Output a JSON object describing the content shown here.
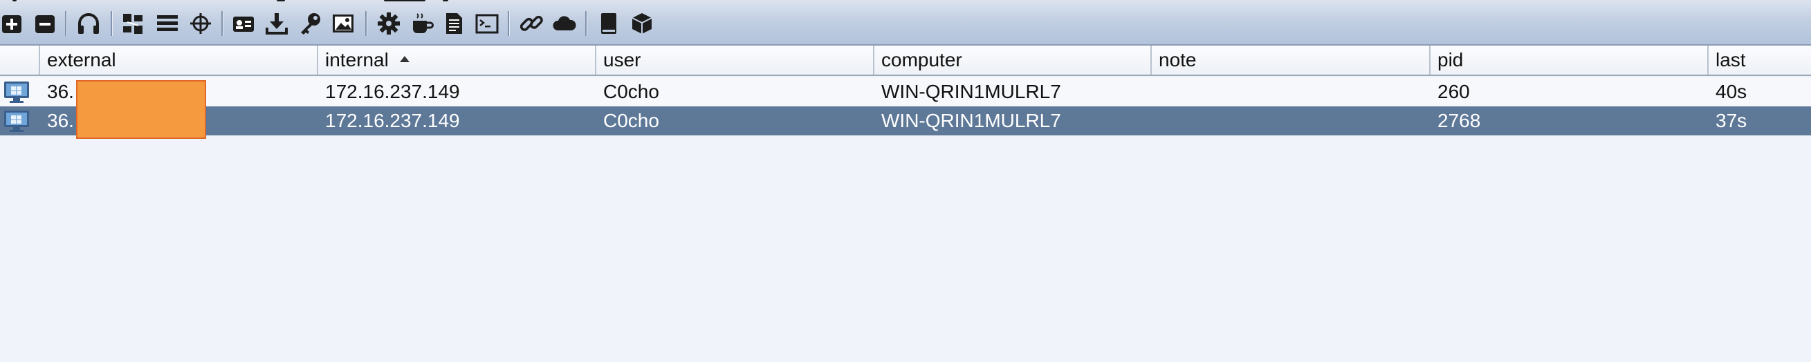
{
  "toolbar": {
    "buttons": [
      {
        "icon": "connect-plus-icon"
      },
      {
        "icon": "disconnect-minus-icon"
      },
      {
        "icon": "headphones-listeners-icon"
      },
      {
        "icon": "pivot-graph-icon"
      },
      {
        "icon": "session-table-icon"
      },
      {
        "icon": "targets-crosshair-icon"
      },
      {
        "icon": "credentials-card-icon"
      },
      {
        "icon": "downloads-icon"
      },
      {
        "icon": "keystrokes-key-icon"
      },
      {
        "icon": "screenshots-image-icon"
      },
      {
        "icon": "payload-gear-icon"
      },
      {
        "icon": "java-cup-icon"
      },
      {
        "icon": "script-document-icon"
      },
      {
        "icon": "console-terminal-icon"
      },
      {
        "icon": "link-chain-icon"
      },
      {
        "icon": "cloud-icon"
      },
      {
        "icon": "manual-book-icon"
      },
      {
        "icon": "package-cube-icon"
      }
    ]
  },
  "table": {
    "columns": [
      {
        "label": ""
      },
      {
        "label": "external"
      },
      {
        "label": "internal"
      },
      {
        "label": "user"
      },
      {
        "label": "computer"
      },
      {
        "label": "note"
      },
      {
        "label": "pid"
      },
      {
        "label": "last"
      }
    ],
    "sorted_column": "internal",
    "sort_direction": "ascending",
    "rows": [
      {
        "external": "36.",
        "internal": "172.16.237.149",
        "user": "C0cho",
        "computer": "WIN-QRIN1MULRL7",
        "note": "",
        "pid": "260",
        "last": "40s",
        "selected": false
      },
      {
        "external": "36.",
        "internal": "172.16.237.149",
        "user": "C0cho",
        "computer": "WIN-QRIN1MULRL7",
        "note": "",
        "pid": "2768",
        "last": "37s",
        "selected": true
      }
    ]
  },
  "colors": {
    "selected_row": "#5e7898",
    "redaction": "#f59a3e",
    "toolbar_bg": "#c2cfe2"
  }
}
